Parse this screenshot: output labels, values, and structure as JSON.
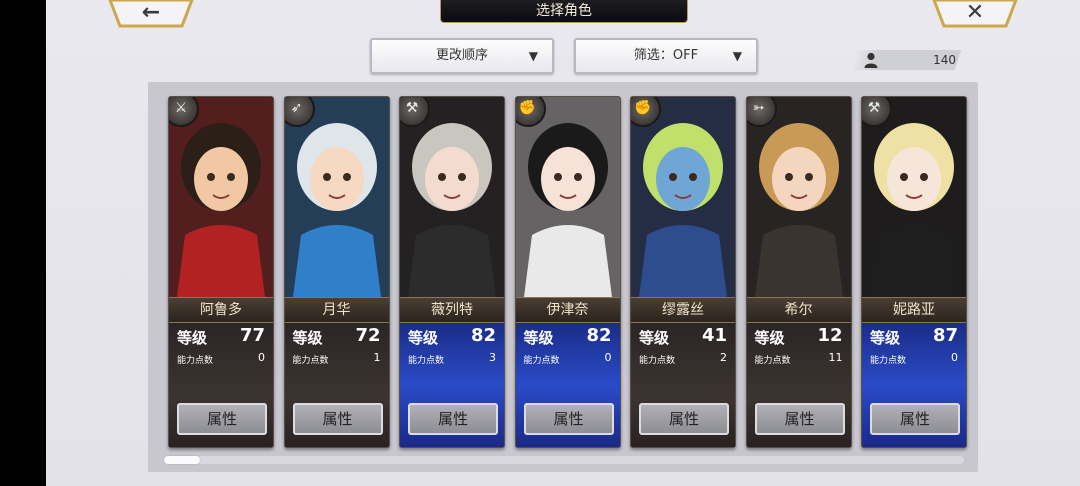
{
  "header": {
    "title": "选择角色",
    "back_icon": "left-arrow-icon",
    "close_icon": "x-close-icon"
  },
  "toolbar": {
    "order_label": "更改顺序",
    "filter_label": "筛选：OFF"
  },
  "counter": {
    "icon": "person-icon",
    "value": "140"
  },
  "labels": {
    "level": "等级",
    "ability_points": "能力点数",
    "attr_button": "属性"
  },
  "characters": [
    {
      "name": "阿鲁多",
      "level": "77",
      "points": "0",
      "weapon": "sword-icon",
      "style": "dark",
      "hair": "#2b1f17",
      "skin": "#f1c7a4",
      "outfit": "#b32222"
    },
    {
      "name": "月华",
      "level": "72",
      "points": "1",
      "weapon": "spear-icon",
      "style": "dark",
      "hair": "#dfe6ea",
      "skin": "#f7d8c2",
      "outfit": "#2f7fc9"
    },
    {
      "name": "薇列特",
      "level": "82",
      "points": "3",
      "weapon": "hammer-icon",
      "style": "blue",
      "hair": "#c9c6c0",
      "skin": "#f3dccf",
      "outfit": "#2c2c2c"
    },
    {
      "name": "伊津奈",
      "level": "82",
      "points": "0",
      "weapon": "fist-icon",
      "style": "blue",
      "hair": "#1a1a1a",
      "skin": "#f6e2d6",
      "outfit": "#e9e9e9"
    },
    {
      "name": "缪露丝",
      "level": "41",
      "points": "2",
      "weapon": "fist-icon",
      "style": "dark",
      "hair": "#bfe06a",
      "skin": "#6fa6d6",
      "outfit": "#2e4d8f"
    },
    {
      "name": "希尔",
      "level": "12",
      "points": "11",
      "weapon": "bow-icon",
      "style": "dark",
      "hair": "#c89a56",
      "skin": "#f4d6bf",
      "outfit": "#3a3430"
    },
    {
      "name": "妮路亚",
      "level": "87",
      "points": "0",
      "weapon": "hammer-icon",
      "style": "blue",
      "hair": "#efe0a3",
      "skin": "#f6e6da",
      "outfit": "#1e1e1e"
    }
  ]
}
